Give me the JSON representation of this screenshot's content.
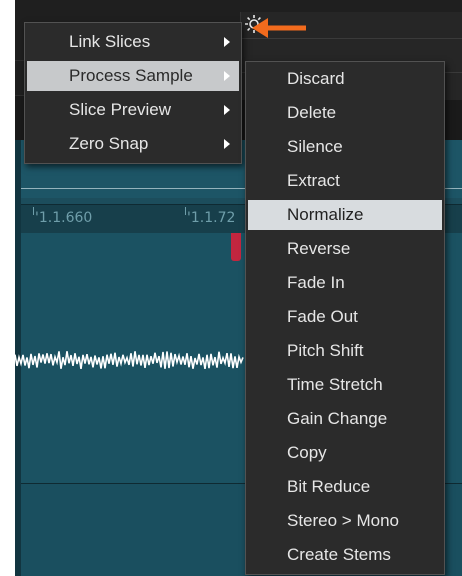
{
  "context_menu": {
    "items": [
      {
        "label": "Link Slices",
        "has_submenu": true
      },
      {
        "label": "Process Sample",
        "has_submenu": true,
        "active": true
      },
      {
        "label": "Slice Preview",
        "has_submenu": true
      },
      {
        "label": "Zero Snap",
        "has_submenu": true
      }
    ]
  },
  "submenu": {
    "items": [
      {
        "label": "Discard"
      },
      {
        "label": "Delete"
      },
      {
        "label": "Silence"
      },
      {
        "label": "Extract"
      },
      {
        "label": "Normalize",
        "hovered": true
      },
      {
        "label": "Reverse"
      },
      {
        "label": "Fade In"
      },
      {
        "label": "Fade Out"
      },
      {
        "label": "Pitch Shift"
      },
      {
        "label": "Time Stretch"
      },
      {
        "label": "Gain Change"
      },
      {
        "label": "Copy"
      },
      {
        "label": "Bit Reduce"
      },
      {
        "label": "Stereo > Mono"
      },
      {
        "label": "Create Stems"
      }
    ]
  },
  "ruler": {
    "labels": [
      "'1.1.660",
      "'1.1.72"
    ]
  },
  "icons": {
    "settings": "gear-icon",
    "pointer": "orange-arrow-icon"
  },
  "colors": {
    "pointer": "#f26b1d",
    "marker": "#c2263f",
    "menu_bg": "#2b2b2b",
    "hover": "#d8dcdf"
  }
}
